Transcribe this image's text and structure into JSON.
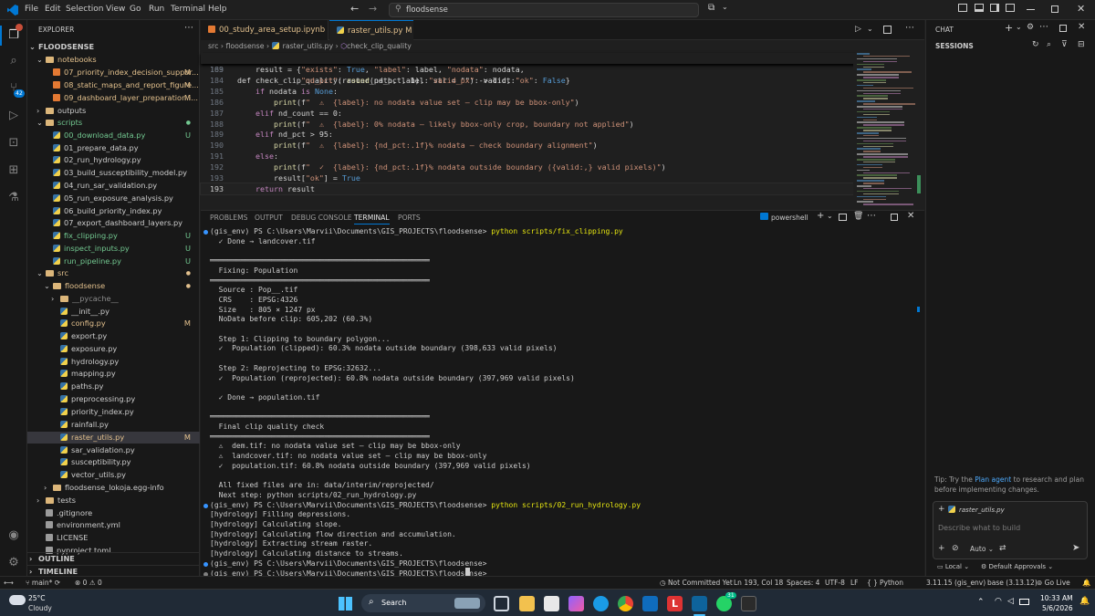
{
  "titlebar": {
    "menus": [
      "File",
      "Edit",
      "Selection",
      "View",
      "Go",
      "Run",
      "Terminal",
      "Help"
    ],
    "search": "floodsense"
  },
  "explorer": {
    "header": "EXPLORER",
    "root": "FLOODSENSE",
    "items": [
      {
        "label": "notebooks",
        "kind": "folder",
        "depth": 1,
        "open": true,
        "color": "#e2c08d",
        "status": ""
      },
      {
        "label": "07_priority_index_decision_suppor...",
        "kind": "nb",
        "depth": 2,
        "color": "#e2c08d",
        "status": "M"
      },
      {
        "label": "08_static_maps_and_report_figure...",
        "kind": "nb",
        "depth": 2,
        "color": "#e2c08d",
        "status": "M"
      },
      {
        "label": "09_dashboard_layer_preparation.i...",
        "kind": "nb",
        "depth": 2,
        "color": "#e2c08d",
        "status": "M"
      },
      {
        "label": "outputs",
        "kind": "folder",
        "depth": 1,
        "open": false,
        "color": "#cccccc",
        "status": ""
      },
      {
        "label": "scripts",
        "kind": "folder",
        "depth": 1,
        "open": true,
        "color": "#73c991",
        "status": "dot"
      },
      {
        "label": "00_download_data.py",
        "kind": "py",
        "depth": 2,
        "color": "#73c991",
        "status": "U"
      },
      {
        "label": "01_prepare_data.py",
        "kind": "py",
        "depth": 2,
        "color": "#cccccc",
        "status": ""
      },
      {
        "label": "02_run_hydrology.py",
        "kind": "py",
        "depth": 2,
        "color": "#cccccc",
        "status": ""
      },
      {
        "label": "03_build_susceptibility_model.py",
        "kind": "py",
        "depth": 2,
        "color": "#cccccc",
        "status": ""
      },
      {
        "label": "04_run_sar_validation.py",
        "kind": "py",
        "depth": 2,
        "color": "#cccccc",
        "status": ""
      },
      {
        "label": "05_run_exposure_analysis.py",
        "kind": "py",
        "depth": 2,
        "color": "#cccccc",
        "status": ""
      },
      {
        "label": "06_build_priority_index.py",
        "kind": "py",
        "depth": 2,
        "color": "#cccccc",
        "status": ""
      },
      {
        "label": "07_export_dashboard_layers.py",
        "kind": "py",
        "depth": 2,
        "color": "#cccccc",
        "status": ""
      },
      {
        "label": "fix_clipping.py",
        "kind": "py",
        "depth": 2,
        "color": "#73c991",
        "status": "U"
      },
      {
        "label": "inspect_inputs.py",
        "kind": "py",
        "depth": 2,
        "color": "#73c991",
        "status": "U"
      },
      {
        "label": "run_pipeline.py",
        "kind": "py",
        "depth": 2,
        "color": "#73c991",
        "status": "U"
      },
      {
        "label": "src",
        "kind": "folder",
        "depth": 1,
        "open": true,
        "color": "#e2c08d",
        "status": "dot"
      },
      {
        "label": "floodsense",
        "kind": "folder",
        "depth": 2,
        "open": true,
        "color": "#e2c08d",
        "status": "dot"
      },
      {
        "label": "__pycache__",
        "kind": "folder",
        "depth": 3,
        "open": false,
        "color": "#8c8c8c",
        "status": ""
      },
      {
        "label": "__init__.py",
        "kind": "py",
        "depth": 3,
        "color": "#cccccc",
        "status": ""
      },
      {
        "label": "config.py",
        "kind": "py",
        "depth": 3,
        "color": "#e2c08d",
        "status": "M"
      },
      {
        "label": "export.py",
        "kind": "py",
        "depth": 3,
        "color": "#cccccc",
        "status": ""
      },
      {
        "label": "exposure.py",
        "kind": "py",
        "depth": 3,
        "color": "#cccccc",
        "status": ""
      },
      {
        "label": "hydrology.py",
        "kind": "py",
        "depth": 3,
        "color": "#cccccc",
        "status": ""
      },
      {
        "label": "mapping.py",
        "kind": "py",
        "depth": 3,
        "color": "#cccccc",
        "status": ""
      },
      {
        "label": "paths.py",
        "kind": "py",
        "depth": 3,
        "color": "#cccccc",
        "status": ""
      },
      {
        "label": "preprocessing.py",
        "kind": "py",
        "depth": 3,
        "color": "#cccccc",
        "status": ""
      },
      {
        "label": "priority_index.py",
        "kind": "py",
        "depth": 3,
        "color": "#cccccc",
        "status": ""
      },
      {
        "label": "rainfall.py",
        "kind": "py",
        "depth": 3,
        "color": "#cccccc",
        "status": ""
      },
      {
        "label": "raster_utils.py",
        "kind": "py",
        "depth": 3,
        "color": "#e2c08d",
        "status": "M",
        "selected": true
      },
      {
        "label": "sar_validation.py",
        "kind": "py",
        "depth": 3,
        "color": "#cccccc",
        "status": ""
      },
      {
        "label": "susceptibility.py",
        "kind": "py",
        "depth": 3,
        "color": "#cccccc",
        "status": ""
      },
      {
        "label": "vector_utils.py",
        "kind": "py",
        "depth": 3,
        "color": "#cccccc",
        "status": ""
      },
      {
        "label": "floodsense_lokoja.egg-info",
        "kind": "folder",
        "depth": 2,
        "open": false,
        "color": "#cccccc",
        "status": ""
      },
      {
        "label": "tests",
        "kind": "folder",
        "depth": 1,
        "open": false,
        "color": "#cccccc",
        "status": ""
      },
      {
        "label": ".gitignore",
        "kind": "gen",
        "depth": 1,
        "color": "#cccccc",
        "status": ""
      },
      {
        "label": "environment.yml",
        "kind": "gen",
        "depth": 1,
        "color": "#cccccc",
        "status": ""
      },
      {
        "label": "LICENSE",
        "kind": "gen",
        "depth": 1,
        "color": "#cccccc",
        "status": ""
      },
      {
        "label": "pyproject.toml",
        "kind": "gen",
        "depth": 1,
        "color": "#cccccc",
        "status": ""
      }
    ],
    "outline": "OUTLINE",
    "timeline": "TIMELINE"
  },
  "tabs": [
    {
      "label": "00_study_area_setup.ipynb",
      "status": "M",
      "active": false
    },
    {
      "label": "raster_utils.py",
      "status": "M",
      "active": true
    }
  ],
  "breadcrumb": [
    "src",
    "floodsense",
    "raster_utils.py",
    "check_clip_quality"
  ],
  "code": {
    "header_ln": "169",
    "header": "def check_clip_quality(raster_path, label: str = \"\") -> dict:",
    "lines": [
      {
        "ln": "183",
        "text": "    result = {\"exists\": True, \"label\": label, \"nodata\": nodata,"
      },
      {
        "ln": "184",
        "text": "              \"nd_pct\": round(nd_pct, 1), \"valid_px\": valid, \"ok\": False}"
      },
      {
        "ln": "185",
        "text": "    if nodata is None:"
      },
      {
        "ln": "186",
        "text": "        print(f\"  ⚠  {label}: no nodata value set — clip may be bbox-only\")"
      },
      {
        "ln": "187",
        "text": "    elif nd_count == 0:"
      },
      {
        "ln": "188",
        "text": "        print(f\"  ⚠  {label}: 0% nodata — likely bbox-only crop, boundary not applied\")"
      },
      {
        "ln": "189",
        "text": "    elif nd_pct > 95:"
      },
      {
        "ln": "190",
        "text": "        print(f\"  ⚠  {label}: {nd_pct:.1f}% nodata — check boundary alignment\")"
      },
      {
        "ln": "191",
        "text": "    else:"
      },
      {
        "ln": "192",
        "text": "        print(f\"  ✓  {label}: {nd_pct:.1f}% nodata outside boundary ({valid:,} valid pixels)\")"
      },
      {
        "ln": "193",
        "text": "        result[\"ok\"] = True"
      },
      {
        "ln": "193",
        "text": "    return result"
      }
    ]
  },
  "panel": {
    "tabs": [
      "PROBLEMS",
      "OUTPUT",
      "DEBUG CONSOLE",
      "TERMINAL",
      "PORTS"
    ],
    "active_tab": "TERMINAL",
    "shell": "powershell",
    "lines": [
      "(gis_env) PS C:\\Users\\Marvii\\Documents\\GIS_PROJECTS\\floodsense> python scripts/fix_clipping.py",
      "  ✓ Done → landcover.tif",
      "",
      "══════════════════════════════════════════════════",
      "  Fixing: Population",
      "══════════════════════════════════════════════════",
      "  Source : Pop__.tif",
      "  CRS    : EPSG:4326",
      "  Size   : 805 × 1247 px",
      "  NoData before clip: 605,202 (60.3%)",
      "",
      "  Step 1: Clipping to boundary polygon...",
      "  ✓  Population (clipped): 60.3% nodata outside boundary (398,633 valid pixels)",
      "",
      "  Step 2: Reprojecting to EPSG:32632...",
      "  ✓  Population (reprojected): 60.8% nodata outside boundary (397,969 valid pixels)",
      "",
      "  ✓ Done → population.tif",
      "",
      "══════════════════════════════════════════════════",
      "  Final clip quality check",
      "══════════════════════════════════════════════════",
      "  ⚠  dem.tif: no nodata value set — clip may be bbox-only",
      "  ⚠  landcover.tif: no nodata value set — clip may be bbox-only",
      "  ✓  population.tif: 60.8% nodata outside boundary (397,969 valid pixels)",
      "",
      "  All fixed files are in: data/interim/reprojected/",
      "  Next step: python scripts/02_run_hydrology.py",
      "(gis_env) PS C:\\Users\\Marvii\\Documents\\GIS_PROJECTS\\floodsense> python scripts/02_run_hydrology.py",
      "[hydrology] Filling depressions.",
      "[hydrology] Calculating slope.",
      "[hydrology] Calculating flow direction and accumulation.",
      "[hydrology] Extracting stream raster.",
      "[hydrology] Calculating distance to streams.",
      "(gis_env) PS C:\\Users\\Marvii\\Documents\\GIS_PROJECTS\\floodsense>",
      "(gis_env) PS C:\\Users\\Marvii\\Documents\\GIS_PROJECTS\\floodsense> "
    ]
  },
  "chat": {
    "title": "CHAT",
    "sessions": "SESSIONS",
    "tip_prefix": "Tip:",
    "tip_text": " Try the ",
    "tip_link": "Plan agent",
    "tip_rest": " to research and plan before implementing changes.",
    "context_file": "raster_utils.py",
    "placeholder": "Describe what to build",
    "mode": "Auto",
    "local": "Local",
    "approvals": "Default Approvals"
  },
  "status": {
    "branch": "main*",
    "errors": "0",
    "warnings": "0",
    "commit": "Not Committed Yet",
    "position": "Ln 193, Col 18",
    "spaces": "Spaces: 4",
    "encoding": "UTF-8",
    "eol": "LF",
    "braces": "{ }",
    "language": "Python",
    "interpreter": "3.11.15 (gis_env)",
    "base": "base (3.13.12)",
    "golive": "Go Live"
  },
  "taskbar": {
    "weather_temp": "25°C",
    "weather_desc": "Cloudy",
    "search": "Search",
    "time": "10:33 AM",
    "date": "5/6/2026",
    "badge": "31"
  },
  "colors": {
    "accent": "#0078d4",
    "modified": "#e2c08d",
    "untracked": "#73c991"
  }
}
